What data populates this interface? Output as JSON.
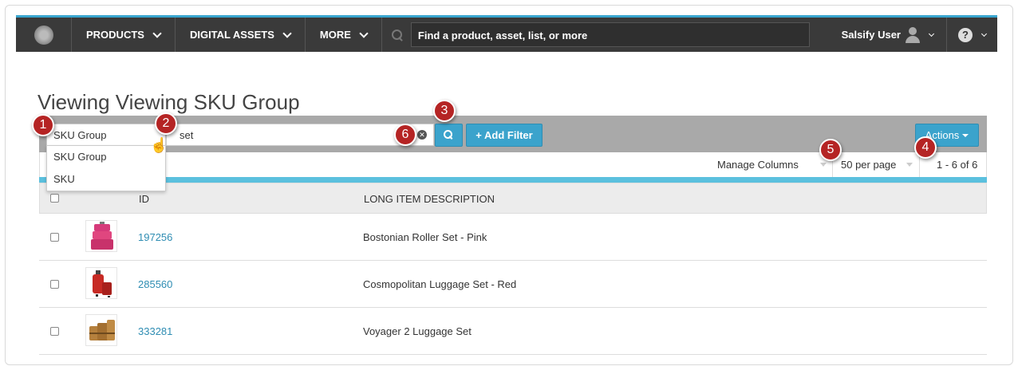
{
  "nav": {
    "products": "PRODUCTS",
    "digital_assets": "DIGITAL ASSETS",
    "more": "MORE",
    "search_placeholder": "Find a product, asset, list, or more",
    "user": "Salsify User"
  },
  "page": {
    "title": "Viewing Viewing SKU Group"
  },
  "toolbar": {
    "type_selected": "SKU Group",
    "search_value": "set",
    "add_filter": "+ Add Filter",
    "actions": "Actions"
  },
  "dropdown": {
    "options": [
      "SKU Group",
      "SKU"
    ]
  },
  "listbar": {
    "manage_columns": "Manage Columns",
    "per_page": "50 per page",
    "count": "1 - 6 of 6"
  },
  "table": {
    "headers": {
      "id": "ID",
      "desc": "LONG ITEM DESCRIPTION"
    },
    "rows": [
      {
        "id": "197256",
        "desc": "Bostonian Roller Set - Pink"
      },
      {
        "id": "285560",
        "desc": "Cosmopolitan Luggage Set - Red"
      },
      {
        "id": "333281",
        "desc": "Voyager 2 Luggage Set"
      }
    ]
  },
  "callouts": [
    "1",
    "2",
    "3",
    "4",
    "5",
    "6"
  ],
  "colors": {
    "nav_bg": "#3a3a3a",
    "accent": "#3ba3cc",
    "callout": "#b52424",
    "link": "#2f8db3"
  }
}
